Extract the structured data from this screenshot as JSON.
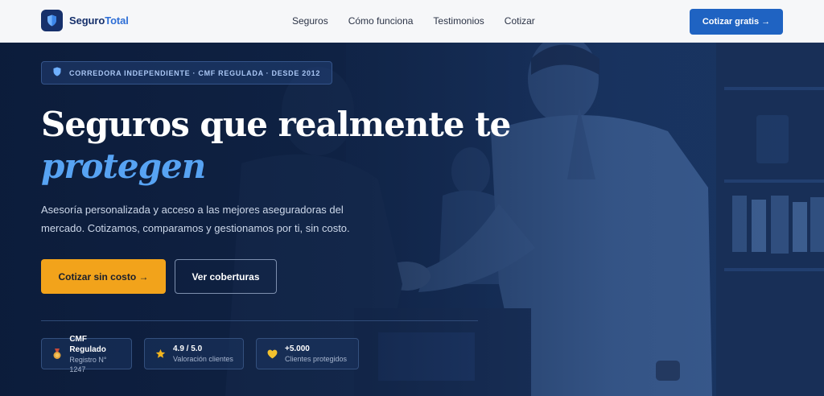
{
  "brand": {
    "name_a": "Seguro",
    "name_b": "Total"
  },
  "nav": {
    "links": [
      "Seguros",
      "Cómo funciona",
      "Testimonios",
      "Cotizar"
    ],
    "cta": "Cotizar gratis →"
  },
  "hero": {
    "badge": "CORREDORA INDEPENDIENTE · CMF REGULADA · DESDE 2012",
    "title_line1": "Seguros que realmente te",
    "title_line2": "protegen",
    "lead": "Asesoría personalizada y acceso a las mejores aseguradoras del mercado. Cotizamos, comparamos y gestionamos por ti, sin costo.",
    "primary_button": "Cotizar sin costo →",
    "secondary_button": "Ver coberturas"
  },
  "stats": [
    {
      "title": "CMF Regulado",
      "subtitle": "Registro N° 1247",
      "icon": "medal-icon"
    },
    {
      "title": "4.9 / 5.0",
      "subtitle": "Valoración clientes",
      "icon": "star-icon"
    },
    {
      "title": "+5.000",
      "subtitle": "Clientes protegidos",
      "icon": "heart-icon"
    }
  ],
  "colors": {
    "navy": "#16306b",
    "accent_blue": "#1f63c2",
    "highlight": "#57a3f3",
    "amber": "#f2a31b"
  }
}
